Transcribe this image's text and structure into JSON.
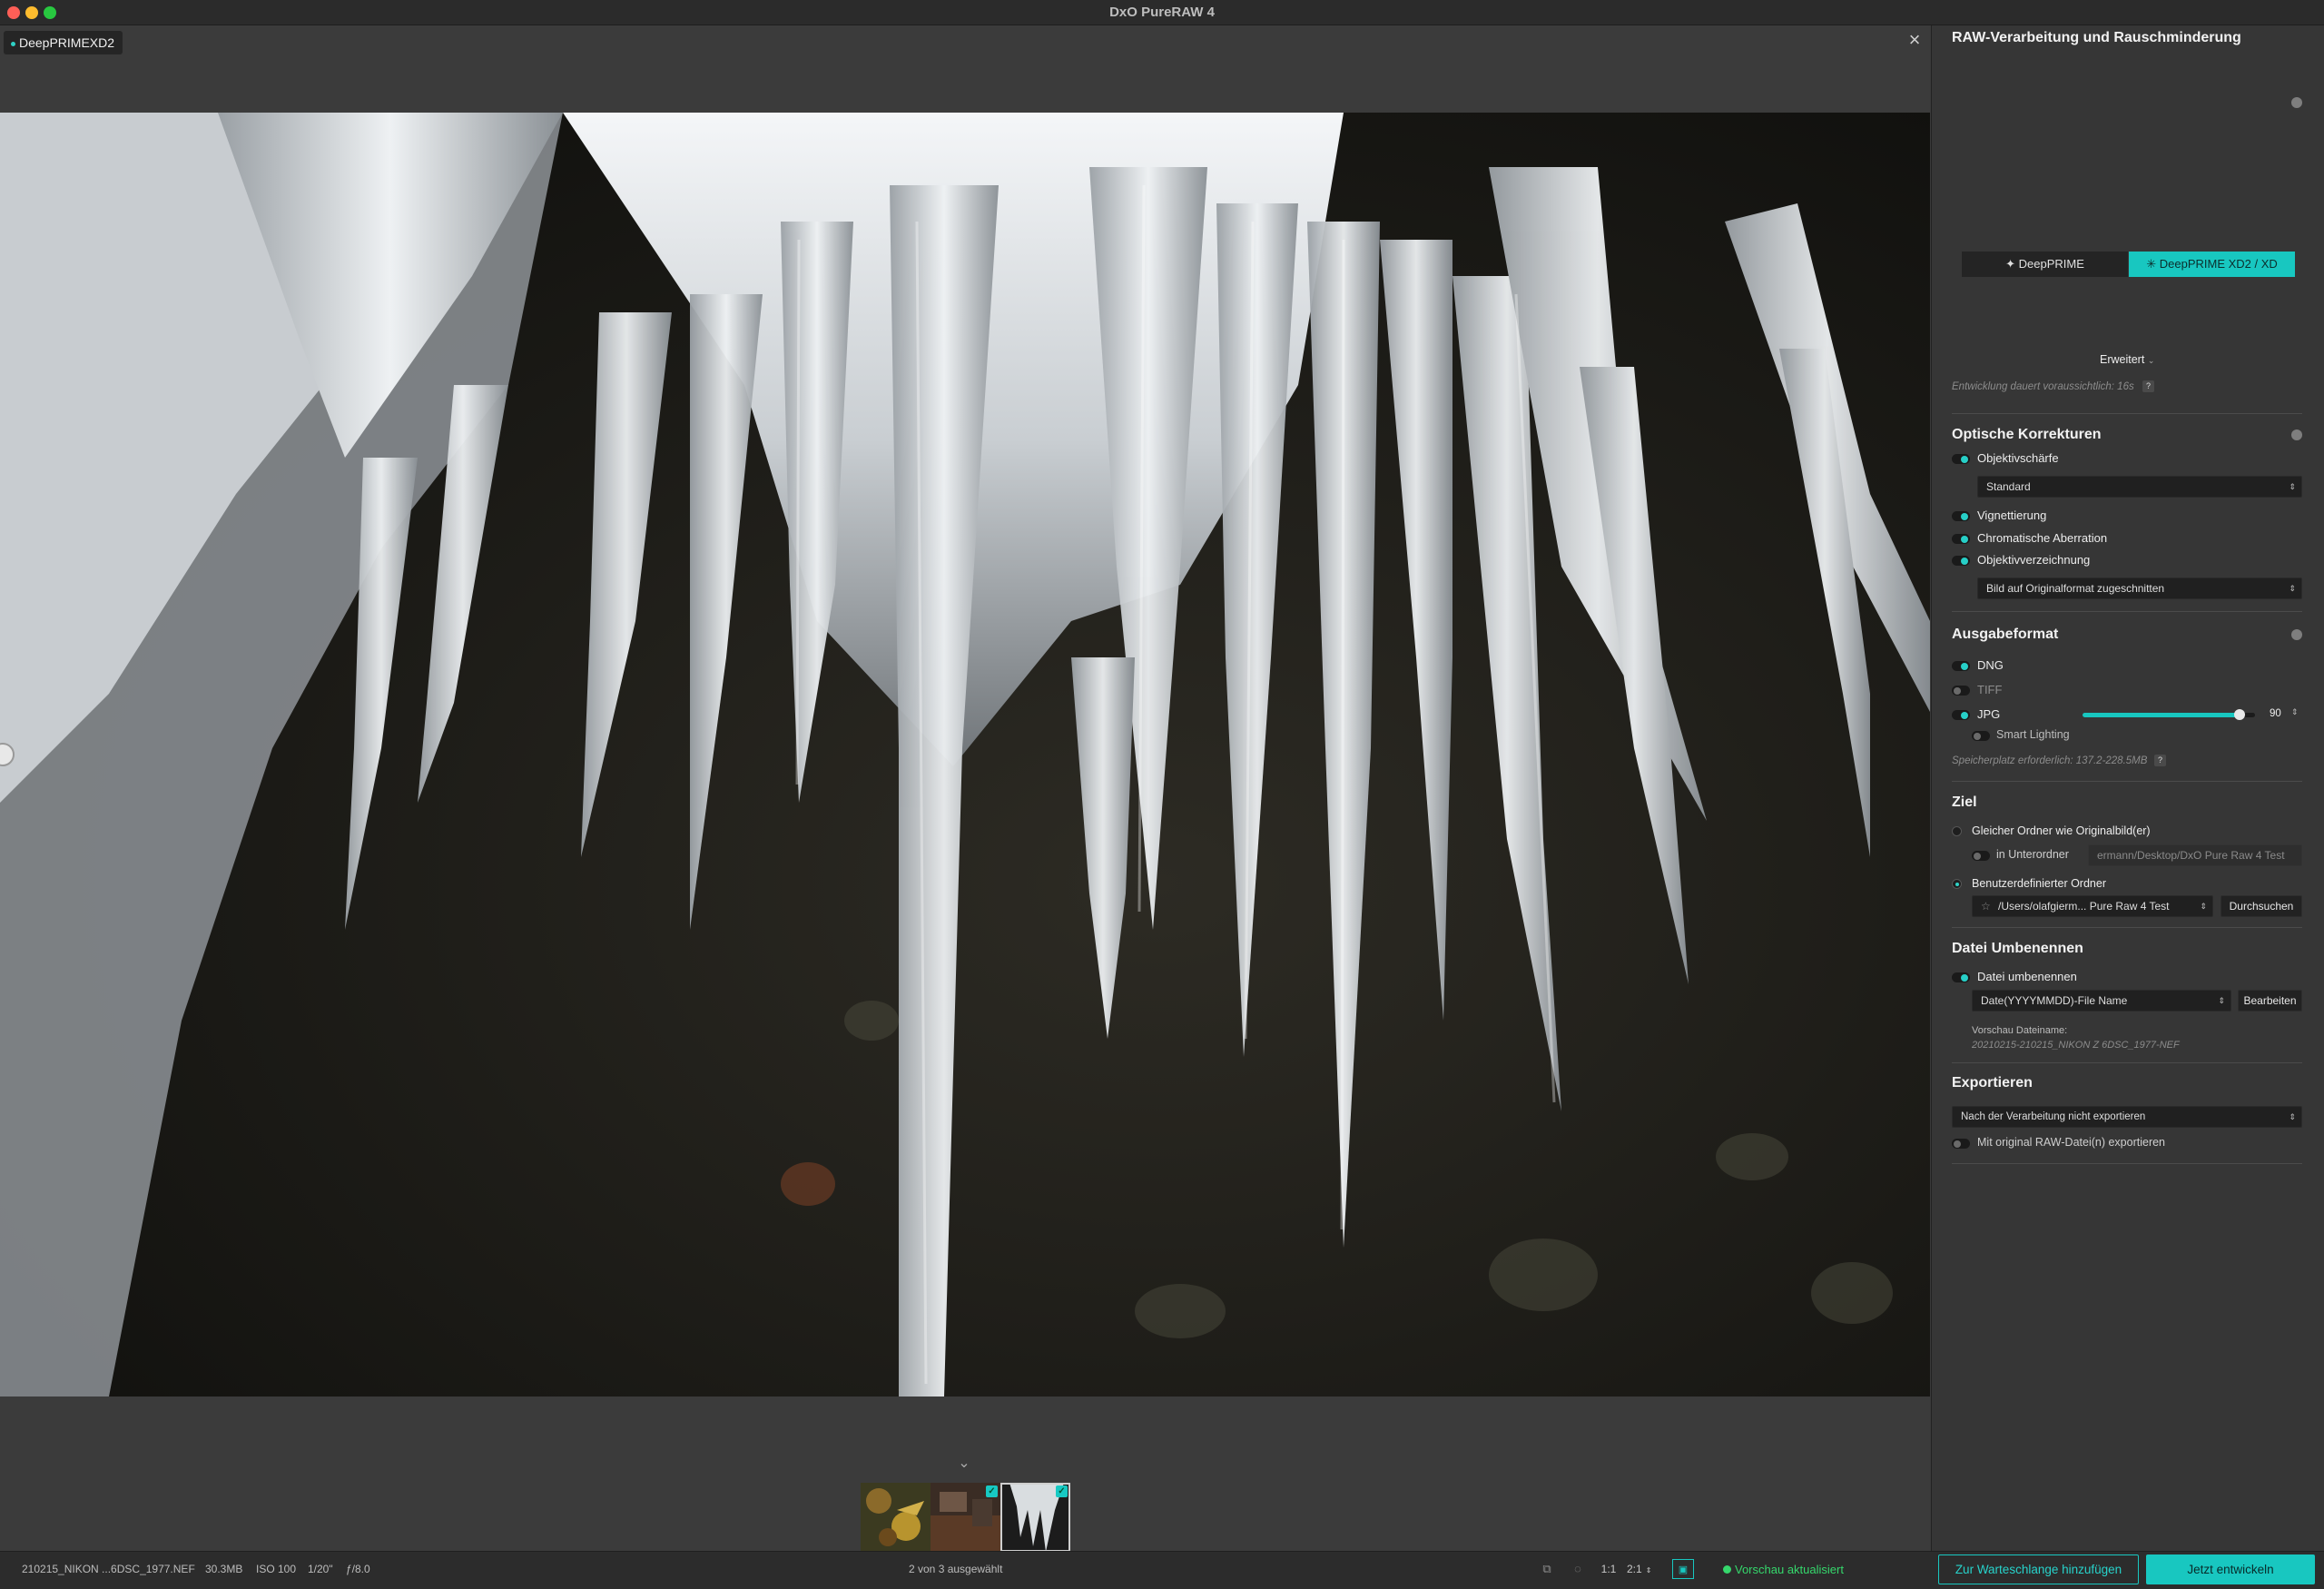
{
  "window": {
    "title": "DxO PureRAW 4"
  },
  "viewer": {
    "tab_label": "DeepPRIMEXD2",
    "close_glyph": "×",
    "filmstrip_toggle_glyph": "⌄",
    "thumbnails": [
      {
        "name": "autumn-leaves",
        "checked": false
      },
      {
        "name": "rust-scene",
        "checked": true
      },
      {
        "name": "icicles",
        "checked": true,
        "active": true
      }
    ]
  },
  "status_bar": {
    "filename": "210215_NIKON ...6DSC_1977.NEF",
    "filesize": "30.3MB",
    "iso": "ISO 100",
    "shutter": "1/20\"",
    "aperture": "ƒ/8.0",
    "selection": "2 von 3 ausgewählt",
    "zoom_1": "1:1",
    "zoom_2": "2:1",
    "preview_status": "Vorschau aktualisiert",
    "queue_button": "Zur Warteschlange hinzufügen",
    "develop_button": "Jetzt entwickeln"
  },
  "panel": {
    "raw": {
      "title": "RAW-Verarbeitung und Rauschminderung",
      "mode_a": "DeepPRIME",
      "mode_b": "DeepPRIME XD2 / XD",
      "mode_a_icon": "✦",
      "mode_b_icon": "✳",
      "advanced": "Erweitert",
      "eta": "Entwicklung dauert voraussichtlich: 16s",
      "help": "?"
    },
    "optics": {
      "title": "Optische Korrekturen",
      "lens_sharpness": "Objektivschärfe",
      "lens_sharpness_value": "Standard",
      "vignetting": "Vignettierung",
      "chromatic": "Chromatische Aberration",
      "distortion": "Objektivverzeichnung",
      "distortion_value": "Bild auf Originalformat zugeschnitten"
    },
    "output": {
      "title": "Ausgabeformat",
      "dng": "DNG",
      "tiff": "TIFF",
      "jpg": "JPG",
      "jpg_quality": "90",
      "jpg_quality_fraction": 0.91,
      "smart_lighting": "Smart Lighting",
      "storage": "Speicherplatz erforderlich: 137.2-228.5MB",
      "help": "?"
    },
    "target": {
      "title": "Ziel",
      "same_folder": "Gleicher Ordner wie Originalbild(er)",
      "subfolder": "in Unterordner",
      "subfolder_path": "ermann/Desktop/DxO Pure Raw 4 Test",
      "custom_folder": "Benutzerdefinierter Ordner",
      "custom_path": "/Users/olafgierm... Pure Raw 4 Test",
      "browse": "Durchsuchen"
    },
    "rename": {
      "title": "Datei Umbenennen",
      "toggle_label": "Datei umbenennen",
      "pattern": "Date(YYYYMMDD)-File Name",
      "edit": "Bearbeiten",
      "preview_label": "Vorschau Dateiname:",
      "preview_value": "20210215-210215_NIKON Z 6DSC_1977-NEF"
    },
    "export": {
      "title": "Exportieren",
      "option": "Nach der Verarbeitung nicht exportieren",
      "with_raw": "Mit original RAW-Datei(n) exportieren"
    }
  },
  "colors": {
    "accent": "#18c7c0",
    "status_green": "#35d86c",
    "panel_bg": "#363636"
  }
}
